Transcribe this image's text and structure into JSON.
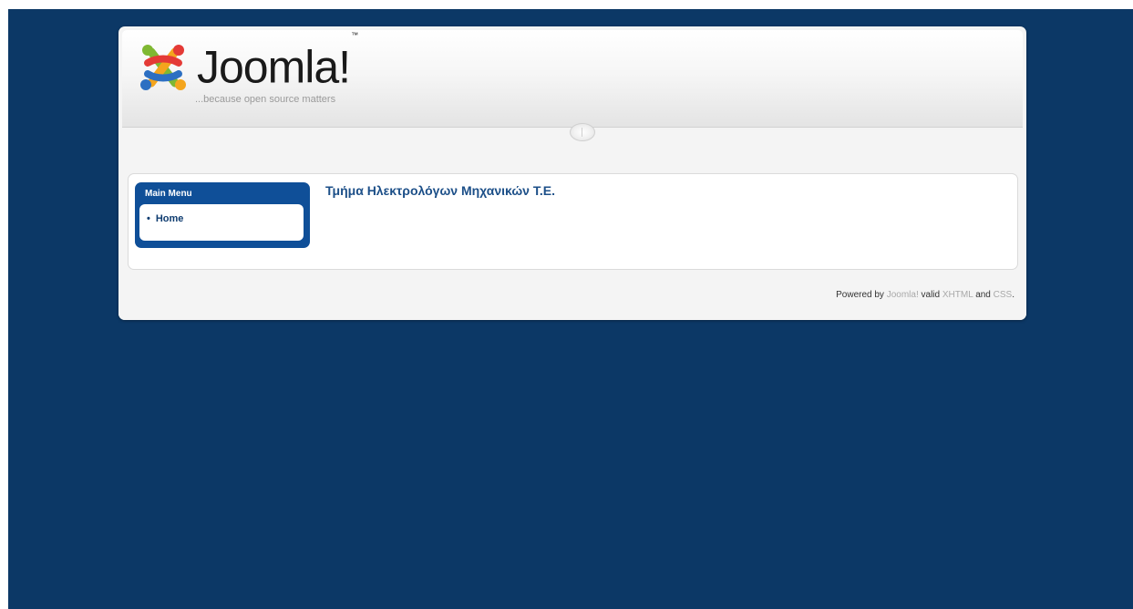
{
  "header": {
    "logo_wordmark": "Joomla!",
    "logo_trademark": "™",
    "tagline": "...because open source matters"
  },
  "menu": {
    "title": "Main Menu",
    "items": [
      {
        "label": "Home"
      }
    ]
  },
  "content": {
    "title": "Τμήμα Ηλεκτρολόγων Μηχανικών Τ.Ε."
  },
  "footer": {
    "prefix": "Powered by",
    "link_joomla": "Joomla!",
    "middle": "valid",
    "link_xhtml": "XHTML",
    "and_text": "and",
    "link_css": "CSS",
    "suffix": "."
  },
  "colors": {
    "page_background": "#0c3866",
    "menu_blue": "#0f4f98",
    "title_blue": "#1c4f88"
  }
}
